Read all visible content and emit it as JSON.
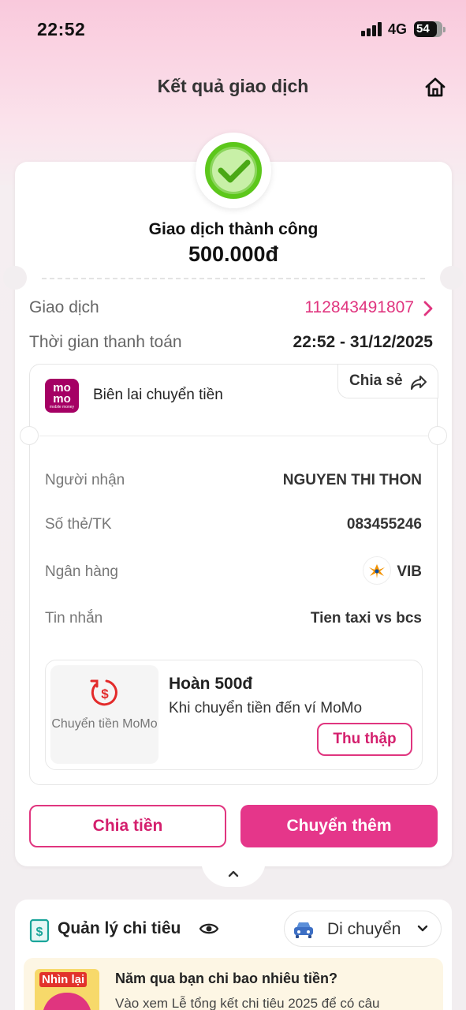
{
  "status_bar": {
    "time": "22:52",
    "network": "4G",
    "battery": "54"
  },
  "header": {
    "title": "Kết quả giao dịch",
    "home_icon": "home-icon"
  },
  "result": {
    "status_text": "Giao dịch thành công",
    "amount": "500.000đ",
    "transaction_label": "Giao dịch",
    "transaction_id": "112843491807",
    "time_label": "Thời gian thanh toán",
    "time_value": "22:52 - 31/12/2025"
  },
  "receipt": {
    "logo_text": "mo mo",
    "logo_subtext": "mobile money",
    "title": "Biên lai chuyển tiền",
    "share_label": "Chia sẻ",
    "rows": [
      {
        "label": "Người nhận",
        "value": "NGUYEN THI THON"
      },
      {
        "label": "Số thẻ/TK",
        "value": "083455246"
      },
      {
        "label": "Ngân hàng",
        "value": "VIB"
      },
      {
        "label": "Tin nhắn",
        "value": "Tien taxi vs bcs"
      }
    ]
  },
  "cashback": {
    "icon_label": "Chuyển tiền MoMo",
    "title": "Hoàn 500đ",
    "subtitle": "Khi chuyển tiền đến ví MoMo",
    "button": "Thu thập"
  },
  "actions": {
    "split": "Chia tiền",
    "transfer_more": "Chuyển thêm"
  },
  "spending": {
    "title": "Quản lý chi tiêu",
    "category": "Di chuyển",
    "promo_badge": "Nhìn lại",
    "promo_title": "Năm qua bạn chi bao nhiêu tiền?",
    "promo_sub": "Vào xem Lễ tổng kết chi tiêu 2025 để có câu"
  },
  "colors": {
    "brand_pink": "#e5368a",
    "success_green": "#5cc71b",
    "momo_purple": "#a50064"
  }
}
